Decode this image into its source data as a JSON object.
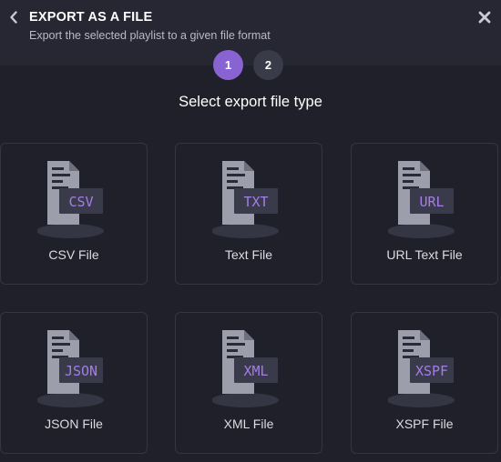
{
  "header": {
    "title": "EXPORT AS A FILE",
    "subtitle": "Export the selected playlist to a given file format",
    "back_icon": "chevron-left-icon",
    "close_icon": "close-icon"
  },
  "stepper": {
    "steps": [
      {
        "label": "1",
        "active": true
      },
      {
        "label": "2",
        "active": false
      }
    ]
  },
  "section_title": "Select export file type",
  "file_types": [
    {
      "ext": "CSV",
      "label": "CSV File"
    },
    {
      "ext": "TXT",
      "label": "Text File"
    },
    {
      "ext": "URL",
      "label": "URL Text File"
    },
    {
      "ext": "JSON",
      "label": "JSON File"
    },
    {
      "ext": "XML",
      "label": "XML File"
    },
    {
      "ext": "XSPF",
      "label": "XSPF File"
    }
  ],
  "colors": {
    "accent": "#8a63d2",
    "icon_body": "#9d9eab",
    "icon_badge": "#3a3b4a",
    "icon_text": "#a47de8"
  }
}
